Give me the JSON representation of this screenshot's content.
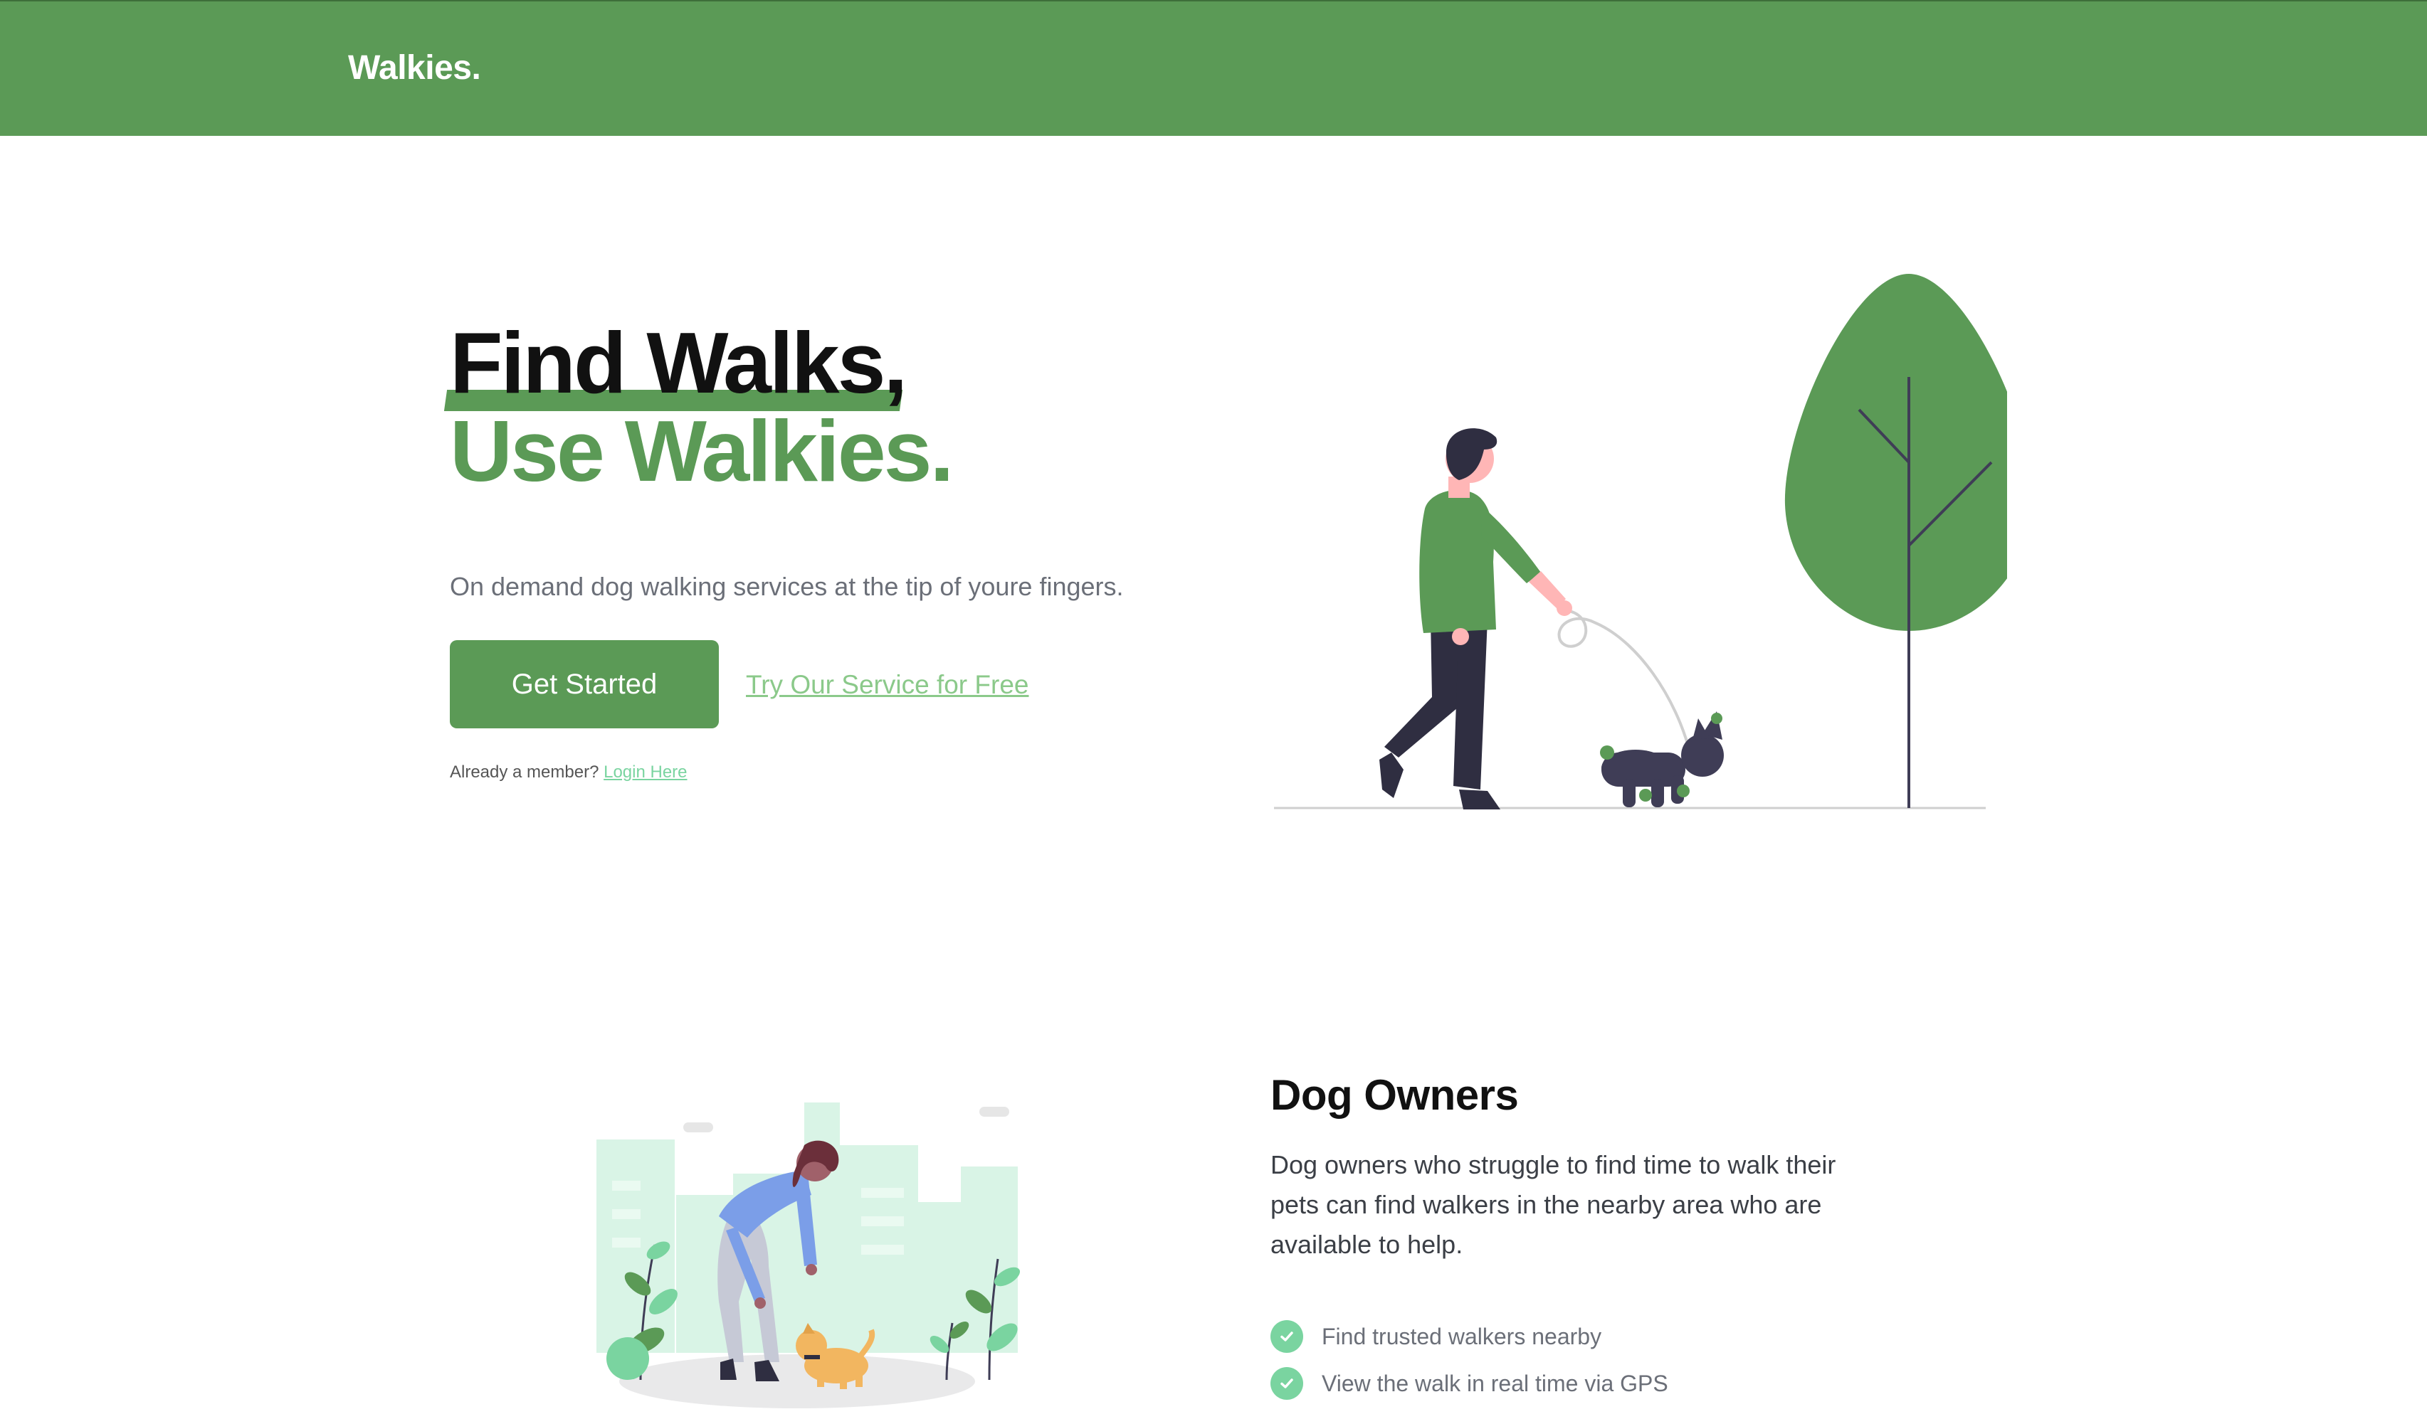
{
  "nav": {
    "brand": "Walkies."
  },
  "hero": {
    "title_line1": "Find Walks,",
    "title_line2": "Use Walkies.",
    "subtitle": "On demand dog walking services at the tip of youre fingers.",
    "cta_primary": "Get Started",
    "cta_secondary": "Try Our Service for Free",
    "member_prompt": "Already a member?",
    "login_link": "Login Here",
    "illustration_icon": "man-walking-dog-illustration"
  },
  "owners": {
    "title": "Dog Owners",
    "description": "Dog owners who struggle to find time to walk their pets can find walkers in the nearby area who are available to help.",
    "features": [
      {
        "label": "Find trusted walkers nearby",
        "icon": "check-circle-icon"
      },
      {
        "label": "View the walk in real time via GPS",
        "icon": "check-circle-icon"
      }
    ],
    "illustration_icon": "woman-petting-dog-city-illustration"
  },
  "colors": {
    "brand_green": "#5b9a56",
    "accent_mint": "#7ad4a0",
    "link_light_green": "#8bc98a",
    "muted_text": "#6b6f78"
  }
}
